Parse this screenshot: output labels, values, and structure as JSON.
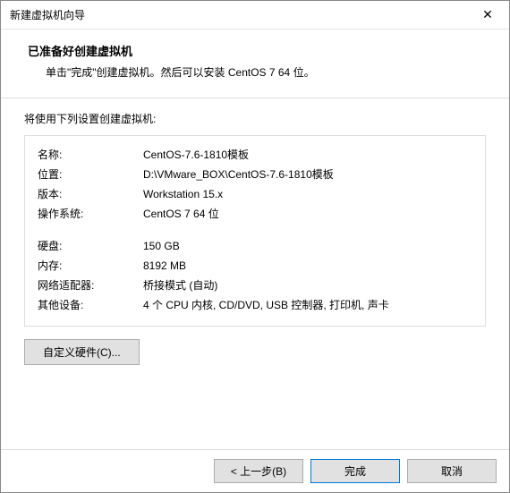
{
  "window": {
    "title": "新建虚拟机向导"
  },
  "header": {
    "heading": "已准备好创建虚拟机",
    "subheading": "单击\"完成\"创建虚拟机。然后可以安装 CentOS 7 64 位。"
  },
  "body": {
    "intro": "将使用下列设置创建虚拟机:",
    "rows1": [
      {
        "label": "名称:",
        "value": "CentOS-7.6-1810模板"
      },
      {
        "label": "位置:",
        "value": "D:\\VMware_BOX\\CentOS-7.6-1810模板"
      },
      {
        "label": "版本:",
        "value": "Workstation 15.x"
      },
      {
        "label": "操作系统:",
        "value": "CentOS 7 64 位"
      }
    ],
    "rows2": [
      {
        "label": "硬盘:",
        "value": "150 GB"
      },
      {
        "label": "内存:",
        "value": "8192 MB"
      },
      {
        "label": "网络适配器:",
        "value": "桥接模式 (自动)"
      },
      {
        "label": "其他设备:",
        "value": "4 个 CPU 内核, CD/DVD, USB 控制器, 打印机, 声卡"
      }
    ],
    "customize_label": "自定义硬件(C)..."
  },
  "footer": {
    "back_label": "< 上一步(B)",
    "finish_label": "完成",
    "cancel_label": "取消"
  }
}
